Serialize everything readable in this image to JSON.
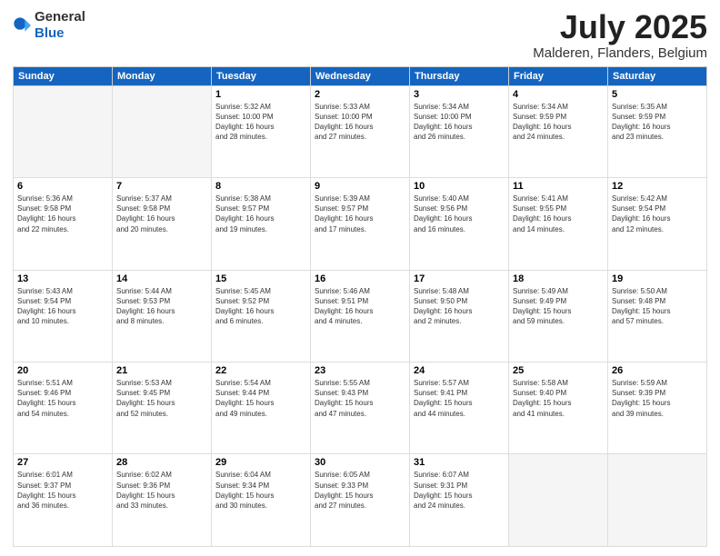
{
  "logo": {
    "general": "General",
    "blue": "Blue"
  },
  "header": {
    "month": "July 2025",
    "location": "Malderen, Flanders, Belgium"
  },
  "weekdays": [
    "Sunday",
    "Monday",
    "Tuesday",
    "Wednesday",
    "Thursday",
    "Friday",
    "Saturday"
  ],
  "weeks": [
    [
      {
        "day": "",
        "info": ""
      },
      {
        "day": "",
        "info": ""
      },
      {
        "day": "1",
        "info": "Sunrise: 5:32 AM\nSunset: 10:00 PM\nDaylight: 16 hours\nand 28 minutes."
      },
      {
        "day": "2",
        "info": "Sunrise: 5:33 AM\nSunset: 10:00 PM\nDaylight: 16 hours\nand 27 minutes."
      },
      {
        "day": "3",
        "info": "Sunrise: 5:34 AM\nSunset: 10:00 PM\nDaylight: 16 hours\nand 26 minutes."
      },
      {
        "day": "4",
        "info": "Sunrise: 5:34 AM\nSunset: 9:59 PM\nDaylight: 16 hours\nand 24 minutes."
      },
      {
        "day": "5",
        "info": "Sunrise: 5:35 AM\nSunset: 9:59 PM\nDaylight: 16 hours\nand 23 minutes."
      }
    ],
    [
      {
        "day": "6",
        "info": "Sunrise: 5:36 AM\nSunset: 9:58 PM\nDaylight: 16 hours\nand 22 minutes."
      },
      {
        "day": "7",
        "info": "Sunrise: 5:37 AM\nSunset: 9:58 PM\nDaylight: 16 hours\nand 20 minutes."
      },
      {
        "day": "8",
        "info": "Sunrise: 5:38 AM\nSunset: 9:57 PM\nDaylight: 16 hours\nand 19 minutes."
      },
      {
        "day": "9",
        "info": "Sunrise: 5:39 AM\nSunset: 9:57 PM\nDaylight: 16 hours\nand 17 minutes."
      },
      {
        "day": "10",
        "info": "Sunrise: 5:40 AM\nSunset: 9:56 PM\nDaylight: 16 hours\nand 16 minutes."
      },
      {
        "day": "11",
        "info": "Sunrise: 5:41 AM\nSunset: 9:55 PM\nDaylight: 16 hours\nand 14 minutes."
      },
      {
        "day": "12",
        "info": "Sunrise: 5:42 AM\nSunset: 9:54 PM\nDaylight: 16 hours\nand 12 minutes."
      }
    ],
    [
      {
        "day": "13",
        "info": "Sunrise: 5:43 AM\nSunset: 9:54 PM\nDaylight: 16 hours\nand 10 minutes."
      },
      {
        "day": "14",
        "info": "Sunrise: 5:44 AM\nSunset: 9:53 PM\nDaylight: 16 hours\nand 8 minutes."
      },
      {
        "day": "15",
        "info": "Sunrise: 5:45 AM\nSunset: 9:52 PM\nDaylight: 16 hours\nand 6 minutes."
      },
      {
        "day": "16",
        "info": "Sunrise: 5:46 AM\nSunset: 9:51 PM\nDaylight: 16 hours\nand 4 minutes."
      },
      {
        "day": "17",
        "info": "Sunrise: 5:48 AM\nSunset: 9:50 PM\nDaylight: 16 hours\nand 2 minutes."
      },
      {
        "day": "18",
        "info": "Sunrise: 5:49 AM\nSunset: 9:49 PM\nDaylight: 15 hours\nand 59 minutes."
      },
      {
        "day": "19",
        "info": "Sunrise: 5:50 AM\nSunset: 9:48 PM\nDaylight: 15 hours\nand 57 minutes."
      }
    ],
    [
      {
        "day": "20",
        "info": "Sunrise: 5:51 AM\nSunset: 9:46 PM\nDaylight: 15 hours\nand 54 minutes."
      },
      {
        "day": "21",
        "info": "Sunrise: 5:53 AM\nSunset: 9:45 PM\nDaylight: 15 hours\nand 52 minutes."
      },
      {
        "day": "22",
        "info": "Sunrise: 5:54 AM\nSunset: 9:44 PM\nDaylight: 15 hours\nand 49 minutes."
      },
      {
        "day": "23",
        "info": "Sunrise: 5:55 AM\nSunset: 9:43 PM\nDaylight: 15 hours\nand 47 minutes."
      },
      {
        "day": "24",
        "info": "Sunrise: 5:57 AM\nSunset: 9:41 PM\nDaylight: 15 hours\nand 44 minutes."
      },
      {
        "day": "25",
        "info": "Sunrise: 5:58 AM\nSunset: 9:40 PM\nDaylight: 15 hours\nand 41 minutes."
      },
      {
        "day": "26",
        "info": "Sunrise: 5:59 AM\nSunset: 9:39 PM\nDaylight: 15 hours\nand 39 minutes."
      }
    ],
    [
      {
        "day": "27",
        "info": "Sunrise: 6:01 AM\nSunset: 9:37 PM\nDaylight: 15 hours\nand 36 minutes."
      },
      {
        "day": "28",
        "info": "Sunrise: 6:02 AM\nSunset: 9:36 PM\nDaylight: 15 hours\nand 33 minutes."
      },
      {
        "day": "29",
        "info": "Sunrise: 6:04 AM\nSunset: 9:34 PM\nDaylight: 15 hours\nand 30 minutes."
      },
      {
        "day": "30",
        "info": "Sunrise: 6:05 AM\nSunset: 9:33 PM\nDaylight: 15 hours\nand 27 minutes."
      },
      {
        "day": "31",
        "info": "Sunrise: 6:07 AM\nSunset: 9:31 PM\nDaylight: 15 hours\nand 24 minutes."
      },
      {
        "day": "",
        "info": ""
      },
      {
        "day": "",
        "info": ""
      }
    ]
  ]
}
